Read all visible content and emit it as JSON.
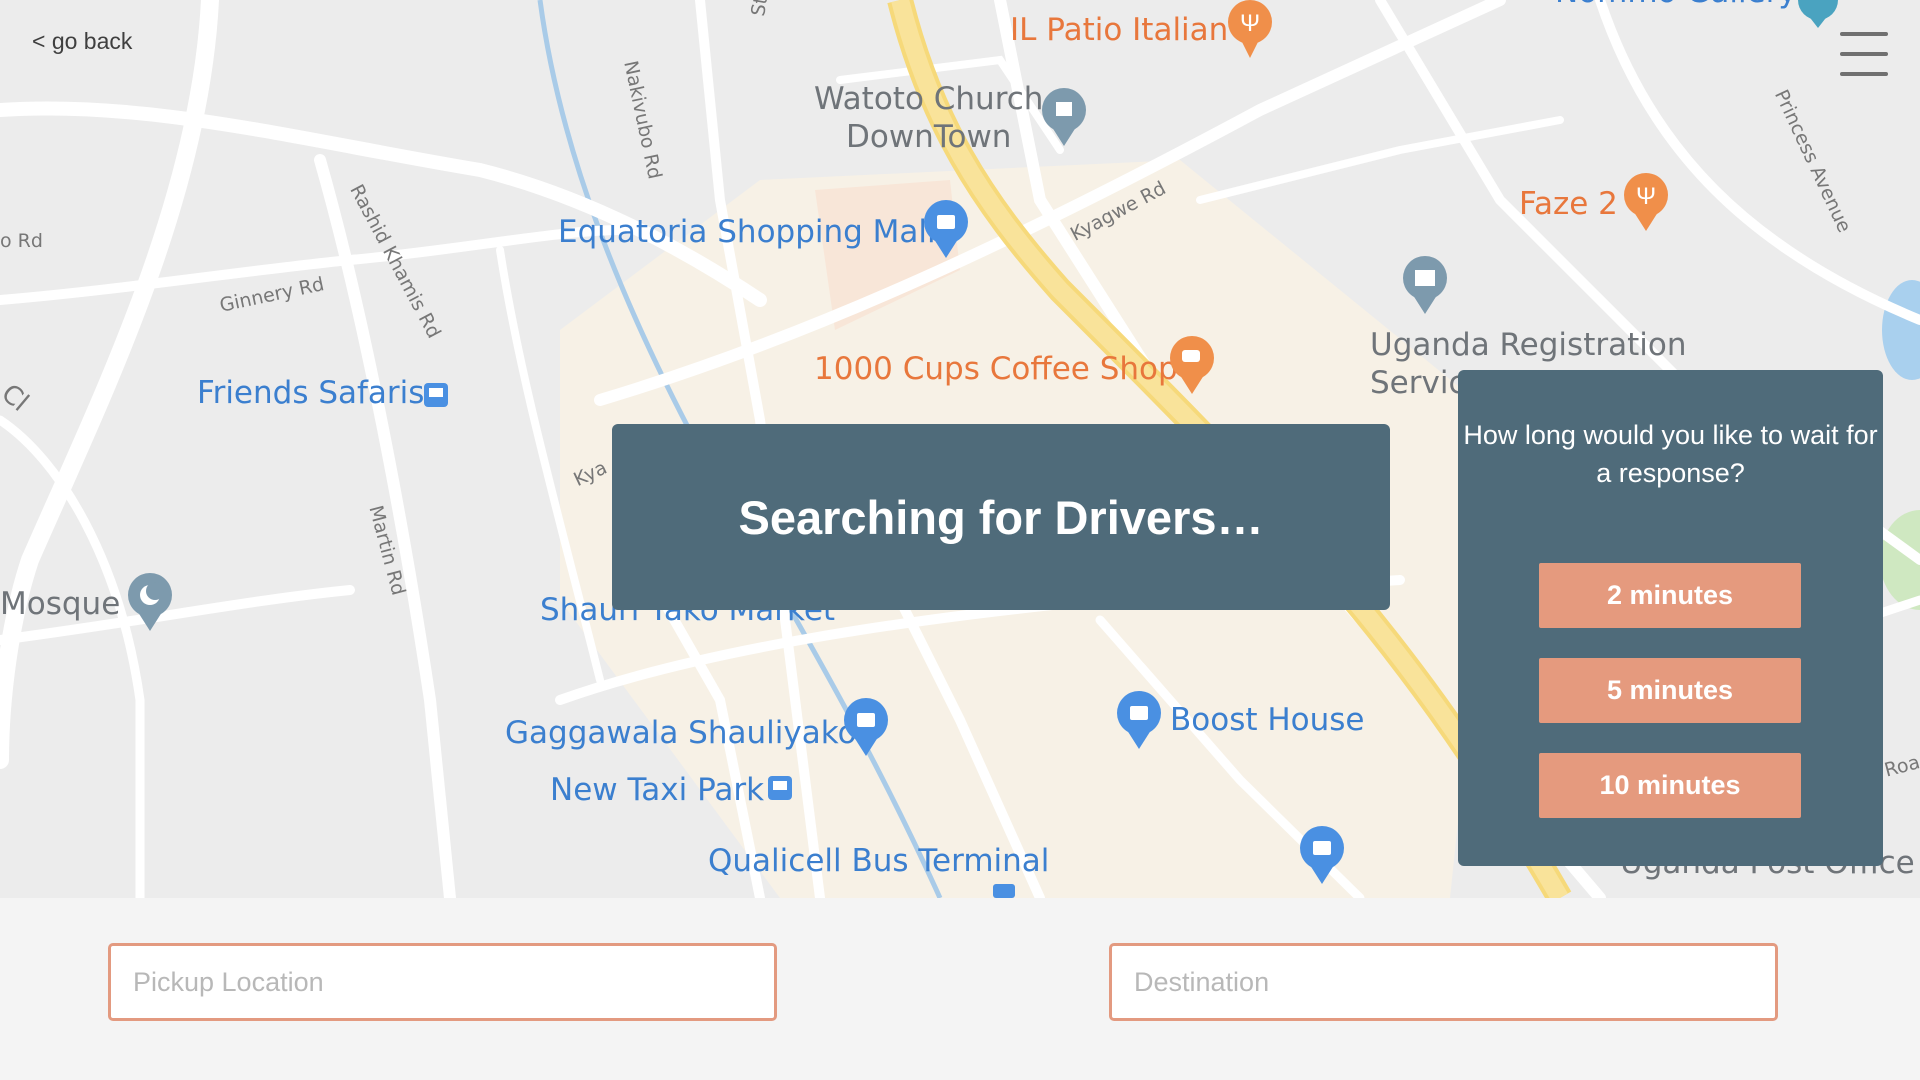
{
  "nav": {
    "back_label": "< go back",
    "menu_icon": "hamburger-menu-icon"
  },
  "map": {
    "pois": [
      {
        "name": "IL Patio Italian",
        "color": "orange",
        "icon": "restaurant-pin-icon"
      },
      {
        "name": "Watoto Church\nDownTown",
        "color": "grey",
        "icon": "church-pin-icon"
      },
      {
        "name": "Equatoria Shopping Mall",
        "color": "blue",
        "icon": "shopping-pin-icon"
      },
      {
        "name": "Faze 2",
        "color": "orange",
        "icon": "restaurant-pin-icon"
      },
      {
        "name": "Uganda Registration\nServic",
        "color": "grey",
        "icon": "government-pin-icon"
      },
      {
        "name": "Friends Safaris",
        "color": "blue",
        "icon": "bus-stop-icon"
      },
      {
        "name": "1000 Cups Coffee Shop",
        "color": "orange",
        "icon": "cafe-pin-icon"
      },
      {
        "name": "Mosque",
        "color": "grey",
        "icon": "mosque-pin-icon"
      },
      {
        "name": "Shauri Yako Market",
        "color": "blue",
        "icon": "shopping-pin-icon"
      },
      {
        "name": "Gaggawala Shauliyako",
        "color": "blue",
        "icon": "shopping-pin-icon"
      },
      {
        "name": "New Taxi Park",
        "color": "blue",
        "icon": "bus-stop-icon"
      },
      {
        "name": "Boost House",
        "color": "blue",
        "icon": "shopping-pin-icon"
      },
      {
        "name": "Qualicell Bus Terminal",
        "color": "blue",
        "icon": "bus-stop-icon"
      },
      {
        "name": "Uganda Post Office",
        "color": "grey",
        "icon": "post-pin-icon"
      },
      {
        "name": "Nommo Gallery",
        "color": "blue",
        "icon": "gallery-pin-icon"
      }
    ],
    "streets": [
      "Nakivubo Rd",
      "Rashid Khamis Rd",
      "Ginnery Rd",
      "Kyagwe Rd",
      "Martin Rd",
      "Princess Avenue",
      "St",
      "o Rd",
      "Cl",
      "Kya",
      "Roa"
    ]
  },
  "status": {
    "banner": "Searching for Drivers…"
  },
  "wait_panel": {
    "question": "How long would you like to wait for a response?",
    "options": [
      "2 minutes",
      "5 minutes",
      "10 minutes"
    ]
  },
  "form": {
    "pickup_placeholder": "Pickup Location",
    "destination_placeholder": "Destination"
  },
  "colors": {
    "panel": "#4f6b7a",
    "accent": "#e59a7e",
    "input_border": "#e39a80",
    "poi_blue": "#3b7fcf",
    "poi_orange": "#e8773c"
  }
}
